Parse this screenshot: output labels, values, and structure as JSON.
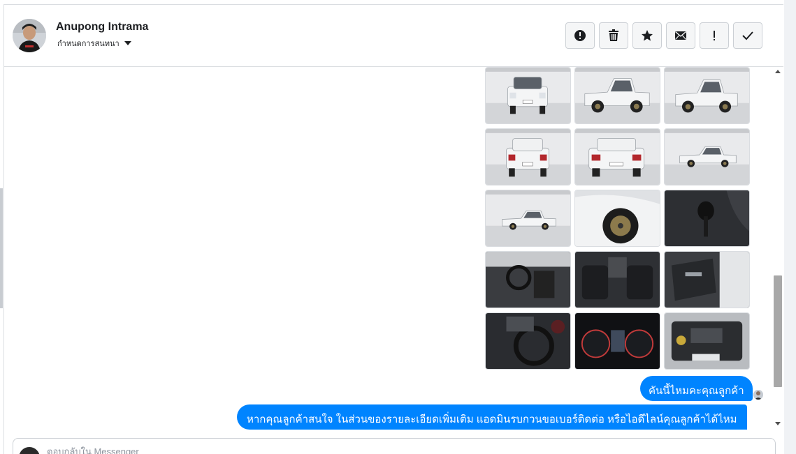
{
  "header": {
    "contact_name": "Anupong Intrama",
    "subtitle": "กำหนดการสนทนา",
    "subtitle_icon": "caret-down-icon",
    "actions": [
      {
        "icon": "alert-circle-icon",
        "name": "report-spam-button"
      },
      {
        "icon": "trash-icon",
        "name": "delete-button"
      },
      {
        "icon": "star-icon",
        "name": "star-button"
      },
      {
        "icon": "envelope-icon",
        "name": "mark-unread-button"
      },
      {
        "icon": "exclamation-icon",
        "name": "follow-up-button"
      },
      {
        "icon": "checkmark-icon",
        "name": "mark-done-button"
      }
    ]
  },
  "photos": [
    {
      "subject": "car-front"
    },
    {
      "subject": "car-front-three-quarter"
    },
    {
      "subject": "car-rear-three-quarter"
    },
    {
      "subject": "car-rear"
    },
    {
      "subject": "car-rear-angled"
    },
    {
      "subject": "car-side-studio"
    },
    {
      "subject": "car-side-studio-left"
    },
    {
      "subject": "car-wheel-closeup"
    },
    {
      "subject": "gear-shifter"
    },
    {
      "subject": "interior-dashboard"
    },
    {
      "subject": "interior-front-seats"
    },
    {
      "subject": "door-panel"
    },
    {
      "subject": "steering-wheel"
    },
    {
      "subject": "instrument-cluster"
    },
    {
      "subject": "engine-bay"
    }
  ],
  "messages": [
    {
      "text": "คันนี้ไหมคะคุณลูกค้า"
    },
    {
      "text": "หากคุณลูกค้าสนใจ ในส่วนของรายละเอียดเพิ่มเติม แอดมินรบกวนขอเบอร์ติดต่อ หรือไอดีไลน์คุณลูกค้าได้ไหม"
    }
  ],
  "composer": {
    "placeholder": "ตอบกลับใน Messenger"
  },
  "colors": {
    "accent": "#0084ff",
    "border": "#dadde1",
    "button_bg": "#f5f6f7"
  }
}
